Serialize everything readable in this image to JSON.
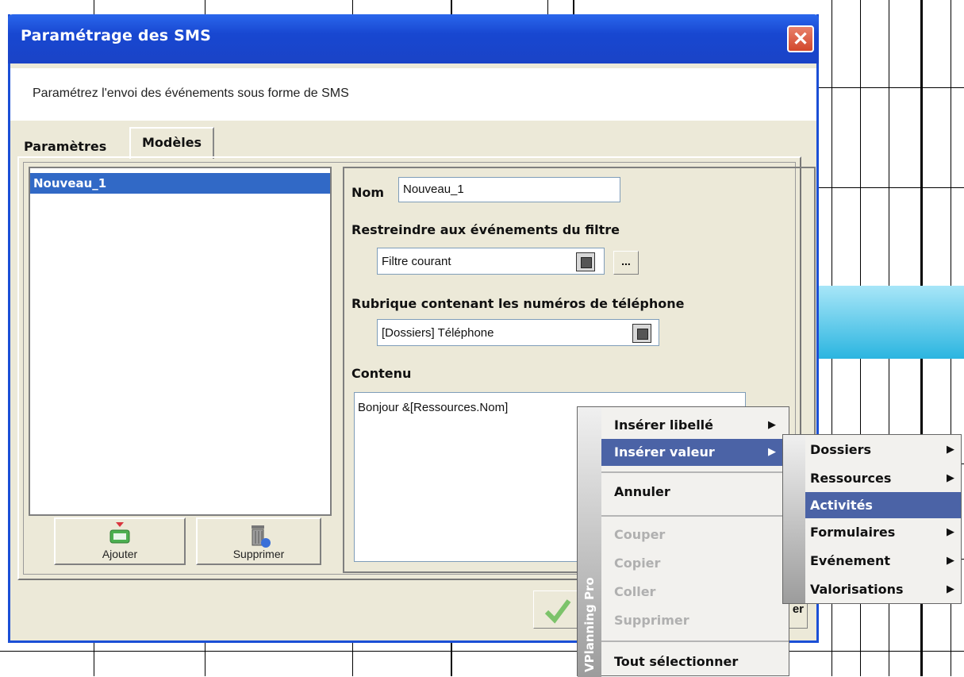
{
  "window": {
    "title": "Paramétrage des SMS",
    "close_glyph": "✕",
    "subtitle": "Paramétrez l'envoi des événements sous forme de SMS"
  },
  "tabs": [
    {
      "label": "Paramètres",
      "active": false
    },
    {
      "label": "Modèles",
      "active": true
    }
  ],
  "templates_list": {
    "items": [
      "Nouveau_1"
    ],
    "selected": "Nouveau_1"
  },
  "buttons": {
    "add_label": "Ajouter",
    "delete_label": "Supprimer",
    "cancel_label_partial": "er"
  },
  "form": {
    "name_label": "Nom",
    "name_value": "Nouveau_1",
    "filter_label": "Restreindre aux événements du filtre",
    "filter_value": "Filtre courant",
    "dots_label": "...",
    "phone_label": "Rubrique contenant les numéros de téléphone",
    "phone_value": "[Dossiers] Téléphone",
    "content_label": "Contenu",
    "content_value": "Bonjour &[Ressources.Nom]"
  },
  "context_menu": {
    "brand": "VPlanning Pro",
    "items": [
      {
        "label": "Insérer libellé",
        "submenu": true,
        "disabled": false
      },
      {
        "label": "Insérer valeur",
        "submenu": true,
        "disabled": false,
        "active": true
      },
      {
        "label": "Annuler",
        "submenu": false,
        "disabled": false
      },
      {
        "label": "Couper",
        "submenu": false,
        "disabled": true
      },
      {
        "label": "Copier",
        "submenu": false,
        "disabled": true
      },
      {
        "label": "Coller",
        "submenu": false,
        "disabled": true
      },
      {
        "label": "Supprimer",
        "submenu": false,
        "disabled": true
      },
      {
        "label": "Tout sélectionner",
        "submenu": false,
        "disabled": false
      }
    ]
  },
  "submenu": {
    "items": [
      {
        "label": "Dossiers",
        "submenu": true
      },
      {
        "label": "Ressources",
        "submenu": true
      },
      {
        "label": "Activités",
        "submenu": false,
        "active": true
      },
      {
        "label": "Formulaires",
        "submenu": true
      },
      {
        "label": "Evénement",
        "submenu": true
      },
      {
        "label": "Valorisations",
        "submenu": true
      }
    ]
  },
  "colors": {
    "titlebar": "#1847d1",
    "selection": "#3169c6",
    "menu_highlight": "#4b63a6",
    "accent_cyan": "#2bb5e0"
  }
}
